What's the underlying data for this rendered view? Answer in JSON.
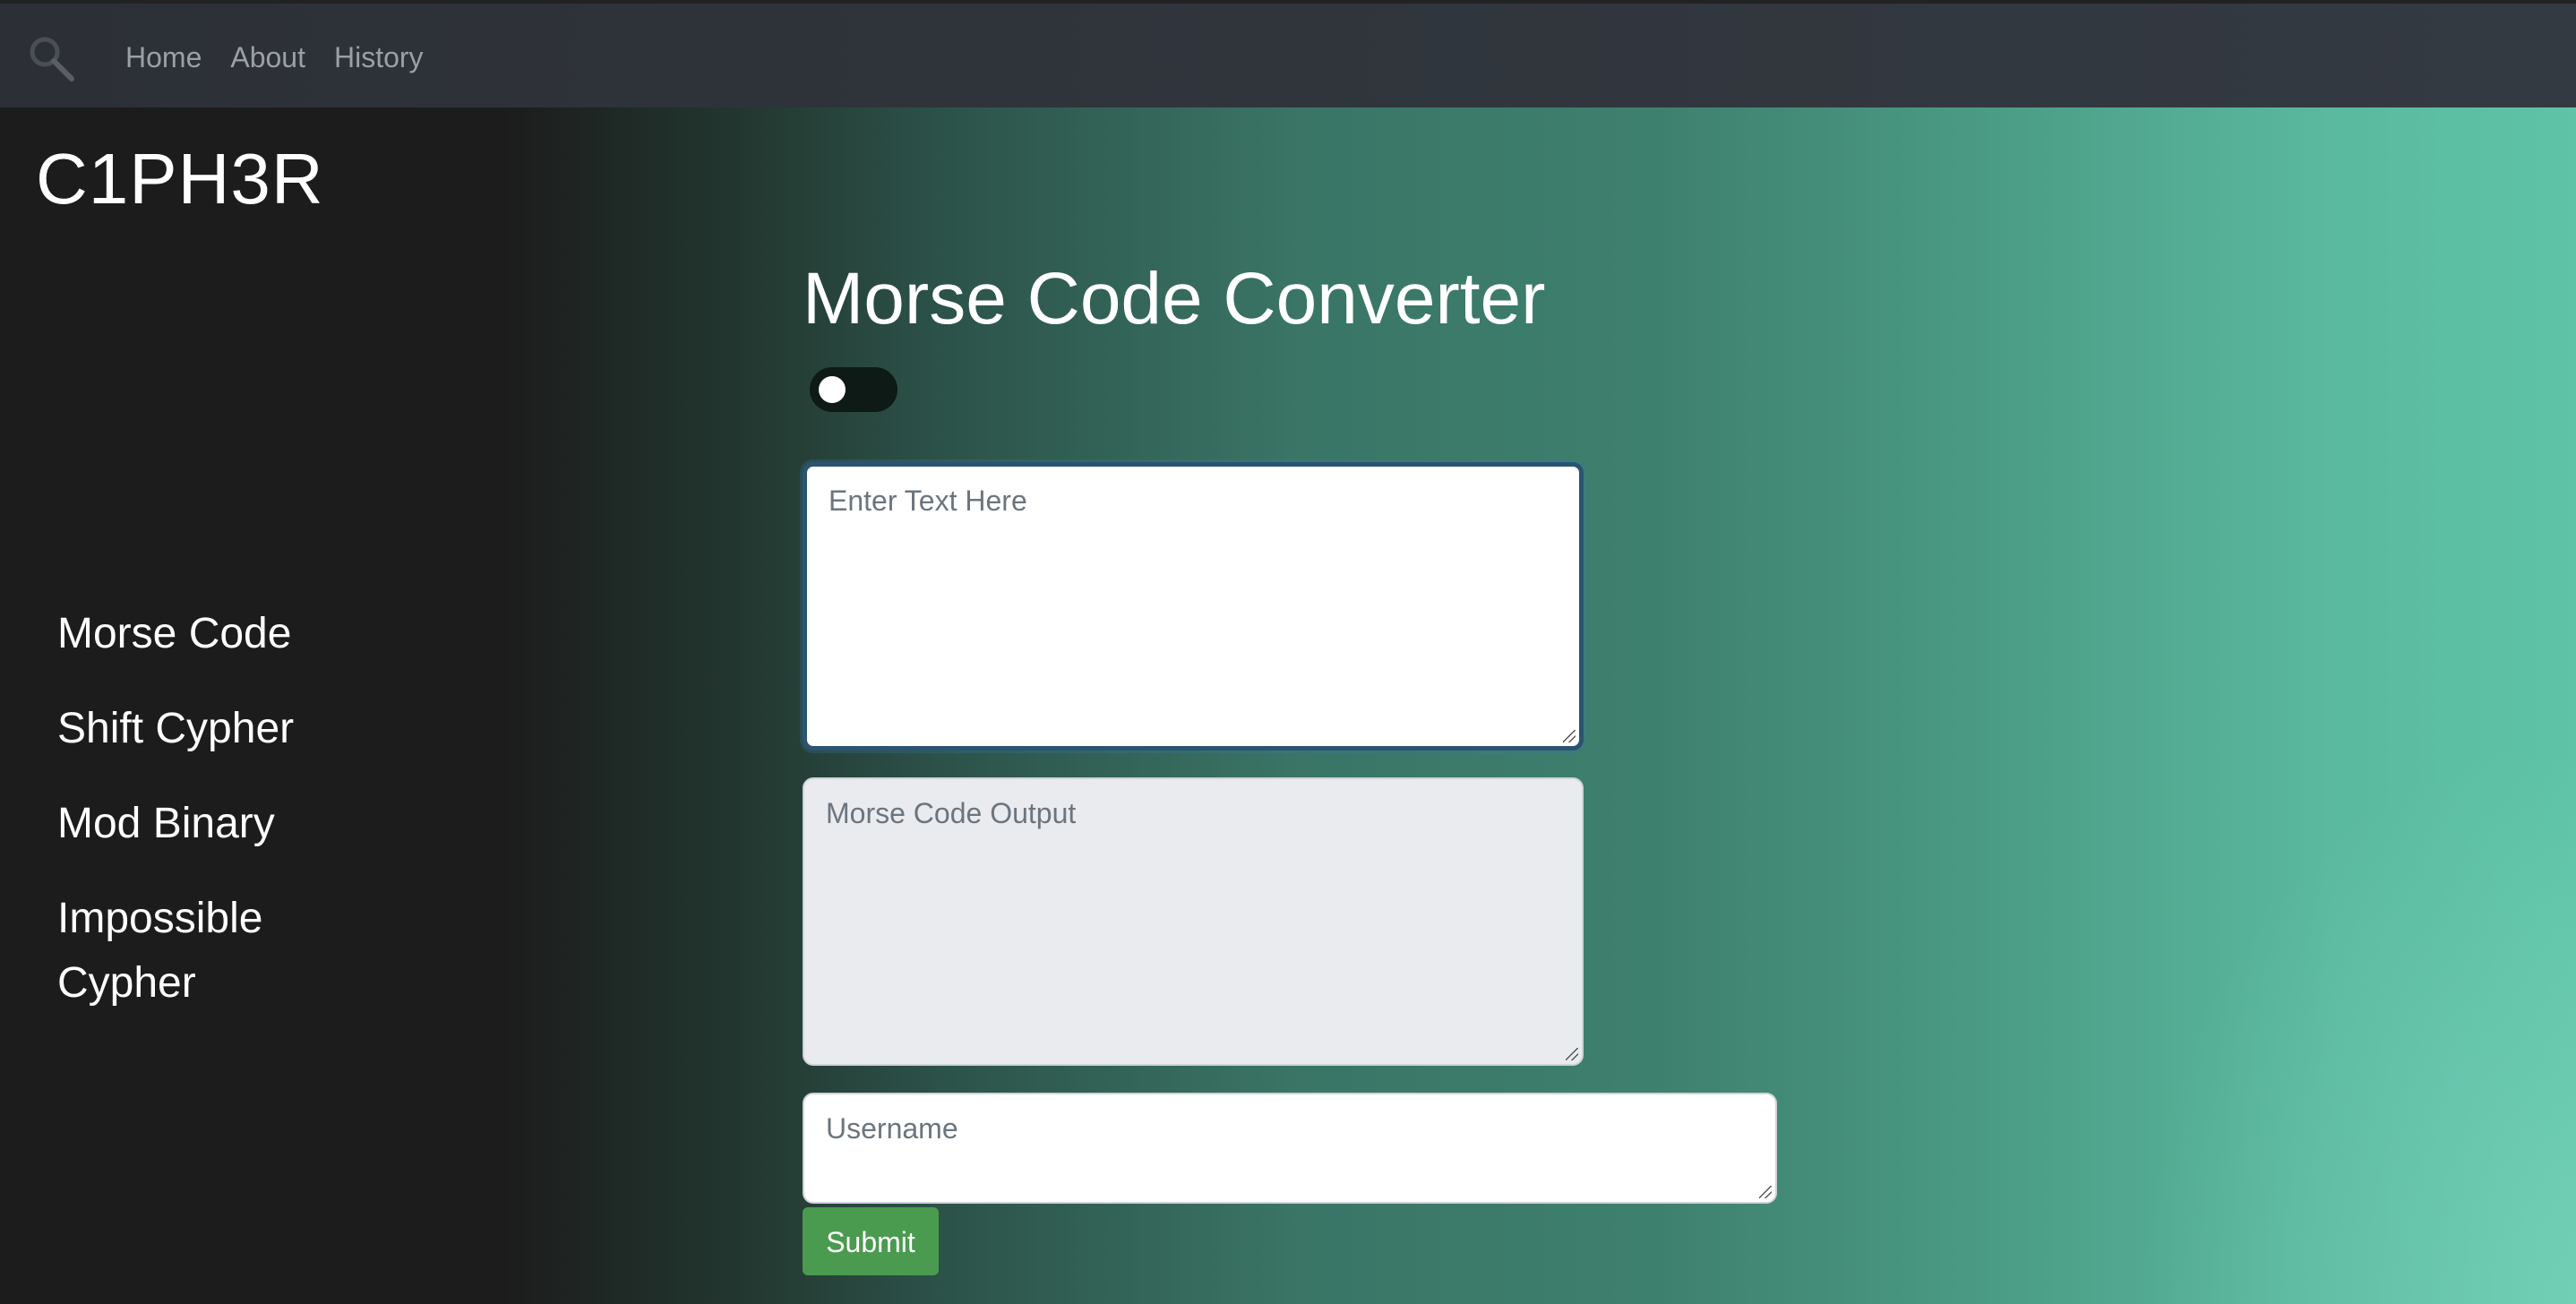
{
  "nav": {
    "brand_icon": "magnifier-icon",
    "links": [
      {
        "label": "Home"
      },
      {
        "label": "About"
      },
      {
        "label": "History"
      }
    ]
  },
  "site_title": "C1PH3R",
  "sidebar": {
    "items": [
      {
        "label": "Morse Code"
      },
      {
        "label": "Shift Cypher"
      },
      {
        "label": "Mod Binary"
      },
      {
        "label": "Impossible Cypher"
      }
    ]
  },
  "main": {
    "title": "Morse Code Converter",
    "toggle": {
      "state": "off"
    },
    "text_input": {
      "value": "",
      "placeholder": "Enter Text Here"
    },
    "output": {
      "value": "",
      "placeholder": "Morse Code Output"
    },
    "username": {
      "value": "",
      "placeholder": "Username"
    },
    "submit_label": "Submit"
  },
  "colors": {
    "navbar": "#343a42",
    "sidebar_bg": "#1c1c1c",
    "gradient_end": "#5ec3a7",
    "submit_button": "#4a9b4f",
    "focus_border": "#2a5470"
  }
}
